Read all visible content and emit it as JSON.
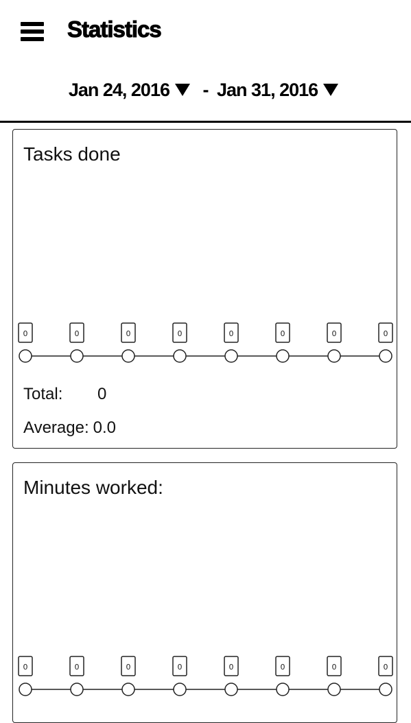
{
  "appbar": {
    "menu_icon": "hamburger-menu-icon",
    "title": "Statistics"
  },
  "date_range": {
    "start": "Jan 24, 2016",
    "separator": "-",
    "end": "Jan 31, 2016",
    "dropdown_icon": "triangle-down-icon"
  },
  "tasks_card": {
    "title": "Tasks done",
    "total_label": "Total:",
    "total_value": "0",
    "average_label": "Average:",
    "average_value": "0.0",
    "chart_data": {
      "type": "line",
      "x": [
        1,
        2,
        3,
        4,
        5,
        6,
        7,
        8
      ],
      "values": [
        0,
        0,
        0,
        0,
        0,
        0,
        0,
        0
      ],
      "data_labels": [
        "0",
        "0",
        "0",
        "0",
        "0",
        "0",
        "0",
        "0"
      ]
    }
  },
  "minutes_card": {
    "title": "Minutes worked:",
    "chart_data": {
      "type": "line",
      "x": [
        1,
        2,
        3,
        4,
        5,
        6,
        7,
        8
      ],
      "values": [
        0,
        0,
        0,
        0,
        0,
        0,
        0,
        0
      ],
      "data_labels": [
        "0",
        "0",
        "0",
        "0",
        "0",
        "0",
        "0",
        "0"
      ]
    }
  }
}
